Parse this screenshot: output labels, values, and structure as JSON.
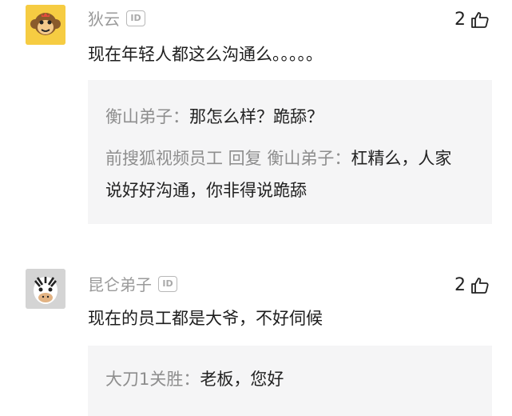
{
  "comments": [
    {
      "author": "狄云",
      "id_badge": "ID",
      "avatar_icon": "monkey-face-icon",
      "likes": "2",
      "text": "现在年轻人都这么沟通么。。。。。",
      "replies": [
        {
          "user": "衡山弟子：",
          "text": "那怎么样？跪舔？"
        },
        {
          "user": "前搜狐视频员工 回复 衡山弟子：",
          "text": "杠精么，人家说好好沟通，你非得说跪舔"
        }
      ]
    },
    {
      "author": "昆仑弟子",
      "id_badge": "ID",
      "avatar_icon": "zebra-face-icon",
      "likes": "2",
      "text": "现在的员工都是大爷，不好伺候",
      "replies": [
        {
          "user": "大刀1关胜：",
          "text": "老板，您好"
        }
      ]
    }
  ],
  "colors": {
    "reply_bg": "#f5f5f6",
    "author": "#9a9a9a",
    "avatar1_bg": "#f6cc42",
    "avatar2_bg": "#d4d4d4"
  }
}
